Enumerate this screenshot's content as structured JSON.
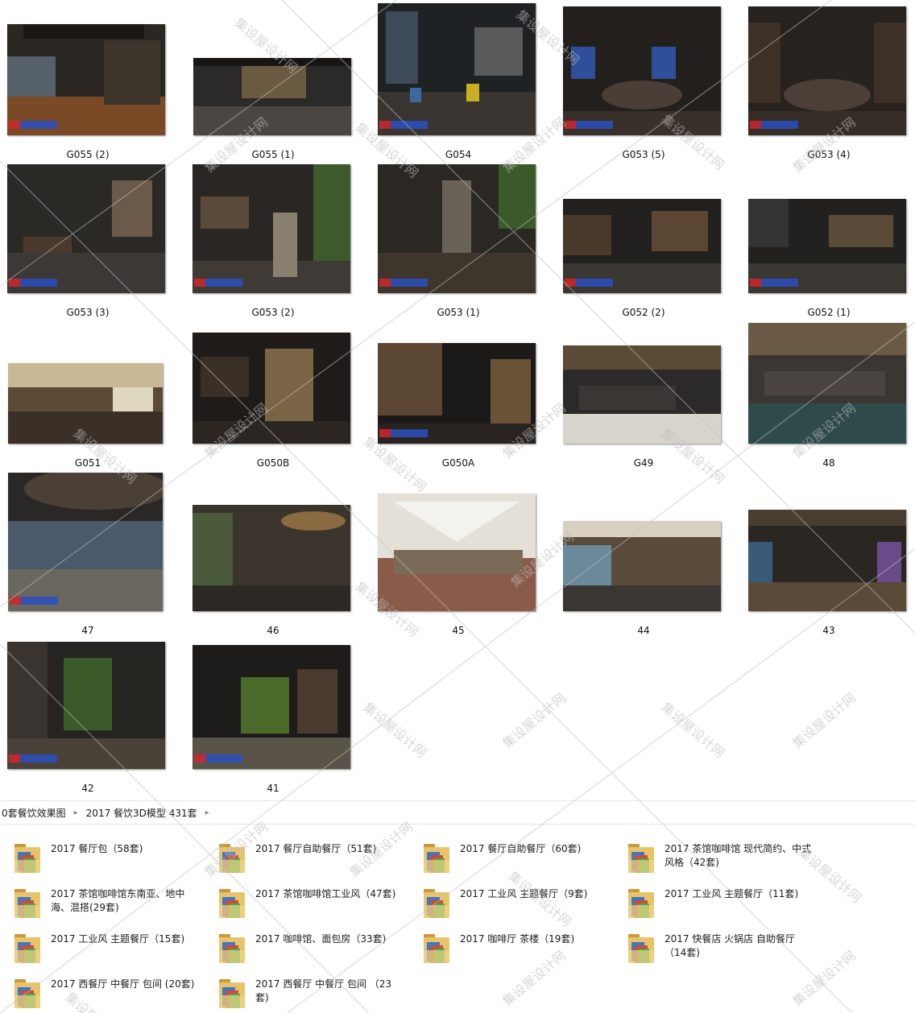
{
  "thumbnails": [
    {
      "label": "G055 (2)"
    },
    {
      "label": "G055 (1)"
    },
    {
      "label": "G054"
    },
    {
      "label": "G053 (5)"
    },
    {
      "label": "G053 (4)"
    },
    {
      "label": "G053 (3)"
    },
    {
      "label": "G053 (2)"
    },
    {
      "label": "G053 (1)"
    },
    {
      "label": "G052 (2)"
    },
    {
      "label": "G052 (1)"
    },
    {
      "label": "G051"
    },
    {
      "label": "G050B"
    },
    {
      "label": "G050A"
    },
    {
      "label": "G49"
    },
    {
      "label": "48"
    },
    {
      "label": "47"
    },
    {
      "label": "46"
    },
    {
      "label": "45"
    },
    {
      "label": "44"
    },
    {
      "label": "43"
    },
    {
      "label": "42"
    },
    {
      "label": "41"
    }
  ],
  "breadcrumb": {
    "items": [
      "0套餐饮效果图",
      "2017 餐饮3D模型 431套"
    ]
  },
  "folders": [
    {
      "label": "2017 餐厅包（58套)"
    },
    {
      "label": "2017 餐厅自助餐厅（51套)"
    },
    {
      "label": "2017 餐厅自助餐厅（60套)"
    },
    {
      "label": "2017 茶馆咖啡馆 现代简约、中式风格（42套)"
    },
    {
      "label": "2017 茶馆咖啡馆东南亚、地中海、混搭(29套)"
    },
    {
      "label": "2017 茶馆咖啡馆工业风（47套)"
    },
    {
      "label": "2017 工业风 主题餐厅（9套)"
    },
    {
      "label": "2017 工业风 主题餐厅（11套)"
    },
    {
      "label": "2017 工业风 主题餐厅（15套)"
    },
    {
      "label": "2017 咖啡馆、面包房（33套)"
    },
    {
      "label": "2017 咖啡厅 茶楼（19套)"
    },
    {
      "label": "2017 快餐店 火锅店 自助餐厅 （14套)"
    },
    {
      "label": "2017 西餐厅 中餐厅 包间 (20套)"
    },
    {
      "label": "2017 西餐厅 中餐厅 包间 （23套)"
    }
  ],
  "watermark": {
    "text": "集设屋设计网"
  },
  "colors": {
    "folder": "#e8c36a",
    "folder_dark": "#c99a3a",
    "accent": "#2a4fc0"
  }
}
